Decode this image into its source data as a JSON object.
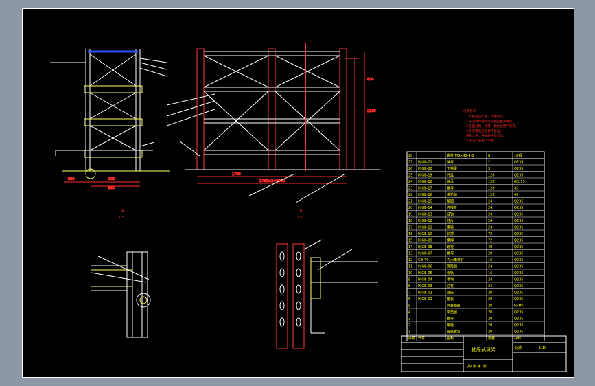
{
  "colors": {
    "background": "#8e97a6",
    "sheet": "#000000",
    "frame": "#ffffff",
    "structure": "#ff3b3b",
    "structure_alt": "#ffffff",
    "dimension": "#ff2a2a",
    "text_label": "#ffffff",
    "table_text": "#ffff00",
    "notes_text": "#ff2a2a",
    "highlight_beam": "#3050ff",
    "hatch": "#ffff66",
    "leader": "#ffffff",
    "grid_line": "#ffffff"
  },
  "views": {
    "section_a_label": "A",
    "section_a_ratio": "1:5",
    "section_b_label": "B",
    "section_b_ratio": "1:5"
  },
  "dimensions": {
    "overall_length": "1780",
    "overall_total": "1780×2=3560",
    "side_width": "600",
    "side_depth": "950",
    "side_left": "980",
    "height_total": "2100",
    "height_seg": "600"
  },
  "parts_table": {
    "header": {
      "no": "序号",
      "code": "代号",
      "name": "名称",
      "qty": "数量",
      "material": "材料"
    },
    "rows": [
      {
        "no": "28",
        "code": "",
        "name": "螺栓 M8×45-4.8",
        "qty": "8",
        "material": "10钢"
      },
      {
        "no": "27",
        "code": "HJGB-21",
        "name": "端板",
        "qty": "2",
        "material": "Q235"
      },
      {
        "no": "26",
        "code": "HJGB-20",
        "name": "下横梁",
        "qty": "3",
        "material": "Q235"
      },
      {
        "no": "25",
        "code": "HJGB-19",
        "name": "托盘",
        "qty": "128",
        "material": "Q235"
      },
      {
        "no": "24",
        "code": "HJGB-18",
        "name": "轴承",
        "qty": "128",
        "material": "GCr15"
      },
      {
        "no": "23",
        "code": "HJGB-17",
        "name": "螺母",
        "qty": "128",
        "material": "45"
      },
      {
        "no": "22",
        "code": "HJGB-16",
        "name": "滚轮轴",
        "qty": "128",
        "material": "45"
      },
      {
        "no": "21",
        "code": "HJGB-15",
        "name": "垫圈",
        "qty": "24",
        "material": "Q235"
      },
      {
        "no": "20",
        "code": "HJGB-14",
        "name": "连接板",
        "qty": "24",
        "material": "Q235"
      },
      {
        "no": "19",
        "code": "HJGB-13",
        "name": "挂钩",
        "qty": "24",
        "material": "Q235"
      },
      {
        "no": "18",
        "code": "HJGB-12",
        "name": "挂片",
        "qty": "24",
        "material": "Q235"
      },
      {
        "no": "17",
        "code": "HJGB-11",
        "name": "横梁",
        "qty": "24",
        "material": "Q235"
      },
      {
        "no": "16",
        "code": "HJGB-10",
        "name": "斜撑",
        "qty": "72",
        "material": "Q235"
      },
      {
        "no": "15",
        "code": "HJGB-09",
        "name": "横撑",
        "qty": "72",
        "material": "Q235"
      },
      {
        "no": "14",
        "code": "HJGB-08",
        "name": "螺栓",
        "qty": "48",
        "material": "Q235"
      },
      {
        "no": "13",
        "code": "HJGB-07",
        "name": "螺母",
        "qty": "20",
        "material": "Q235"
      },
      {
        "no": "12",
        "code": "GB-70",
        "name": "内六角螺钉",
        "qty": "16",
        "material": "Q235"
      },
      {
        "no": "11",
        "code": "HJGB-06",
        "name": "保险销",
        "qty": "24",
        "material": "Q235"
      },
      {
        "no": "10",
        "code": "HJGB-05",
        "name": "滑轨",
        "qty": "16",
        "material": "Q235"
      },
      {
        "no": "9",
        "code": "HJGB-04",
        "name": "滑块",
        "qty": "24",
        "material": "Q235"
      },
      {
        "no": "8",
        "code": "HJGB-03",
        "name": "立柱",
        "qty": "24",
        "material": "Q235"
      },
      {
        "no": "7",
        "code": "HJGB-02",
        "name": "底座",
        "qty": "20",
        "material": "Q235"
      },
      {
        "no": "6",
        "code": "HJGB-01",
        "name": "垫板",
        "qty": "20",
        "material": "Q235"
      },
      {
        "no": "5",
        "code": "",
        "name": "弹簧垫圈",
        "qty": "20",
        "material": "65Mn"
      },
      {
        "no": "4",
        "code": "",
        "name": "平垫圈",
        "qty": "20",
        "material": "Q235"
      },
      {
        "no": "3",
        "code": "",
        "name": "螺母",
        "qty": "20",
        "material": "Q235"
      },
      {
        "no": "2",
        "code": "",
        "name": "螺栓",
        "qty": "20",
        "material": "Q235"
      },
      {
        "no": "1",
        "code": "",
        "name": "膨胀螺栓",
        "qty": "20",
        "material": "Q235"
      }
    ]
  },
  "title_block": {
    "title": "抽屉式货架",
    "sheet_info": "共1张 第1张",
    "scale_label": "比例",
    "scale_value": "1:10"
  },
  "notes": {
    "heading": "技术要求",
    "lines": [
      "1.焊接处应牢固，焊缝均匀。",
      "2.未注明焊缝高度按相应板厚确定。",
      "3.表面处理：喷塑，颜色按用户要求。",
      "4.货架安装后应保持垂直，",
      "  层板水平，各抽屉推拉灵活。",
      "5.未注公差按IT13级。"
    ]
  }
}
